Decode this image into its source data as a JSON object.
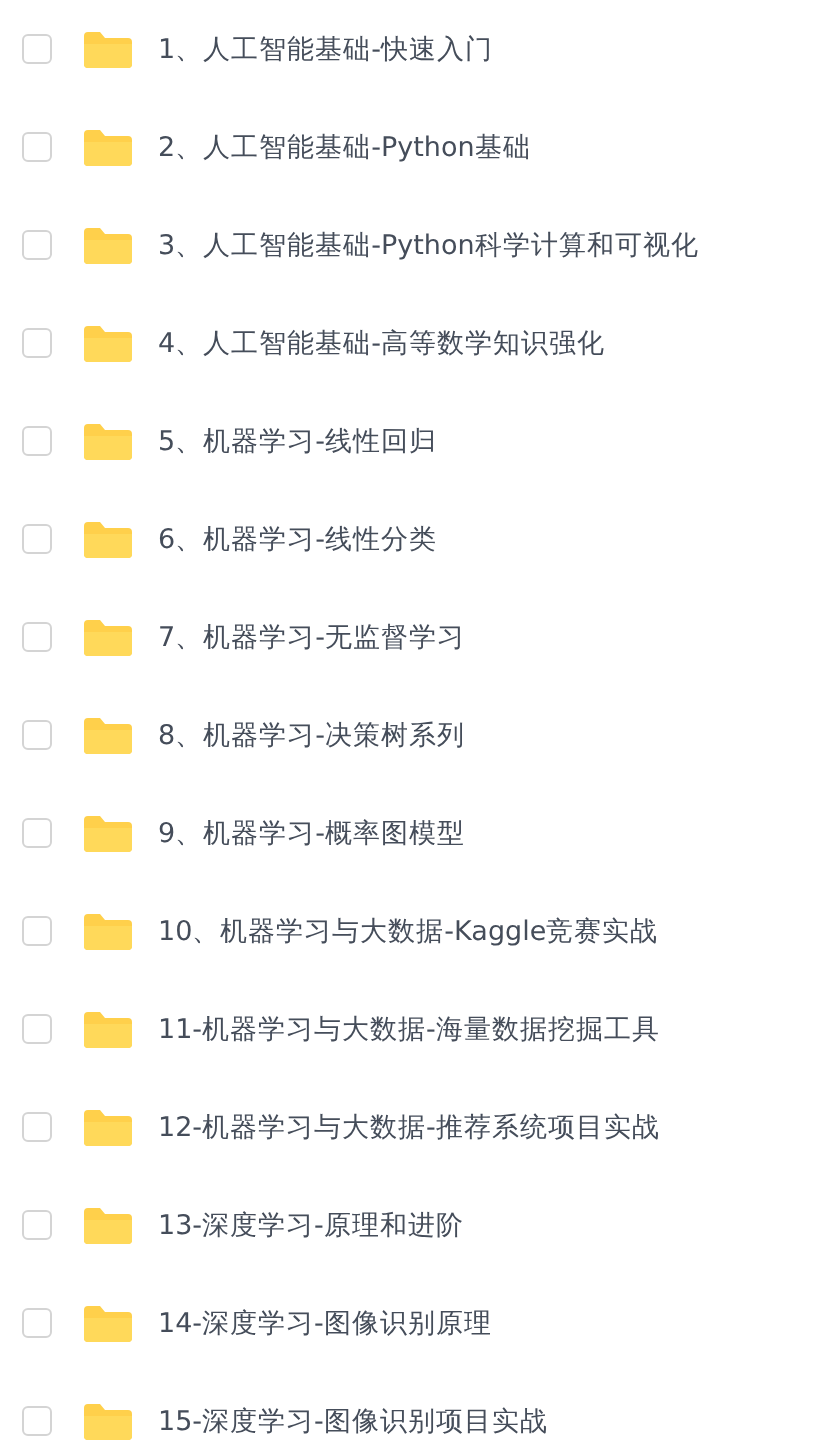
{
  "folders": [
    {
      "name": "1、人工智能基础-快速入门",
      "checked": false
    },
    {
      "name": "2、人工智能基础-Python基础",
      "checked": false
    },
    {
      "name": "3、人工智能基础-Python科学计算和可视化",
      "checked": false
    },
    {
      "name": "4、人工智能基础-高等数学知识强化",
      "checked": false
    },
    {
      "name": "5、机器学习-线性回归",
      "checked": false
    },
    {
      "name": "6、机器学习-线性分类",
      "checked": false
    },
    {
      "name": "7、机器学习-无监督学习",
      "checked": false
    },
    {
      "name": "8、机器学习-决策树系列",
      "checked": false
    },
    {
      "name": "9、机器学习-概率图模型",
      "checked": false
    },
    {
      "name": "10、机器学习与大数据-Kaggle竞赛实战",
      "checked": false
    },
    {
      "name": "11-机器学习与大数据-海量数据挖掘工具",
      "checked": false
    },
    {
      "name": "12-机器学习与大数据-推荐系统项目实战",
      "checked": false
    },
    {
      "name": "13-深度学习-原理和进阶",
      "checked": false
    },
    {
      "name": "14-深度学习-图像识别原理",
      "checked": false
    },
    {
      "name": "15-深度学习-图像识别项目实战",
      "checked": false
    }
  ]
}
